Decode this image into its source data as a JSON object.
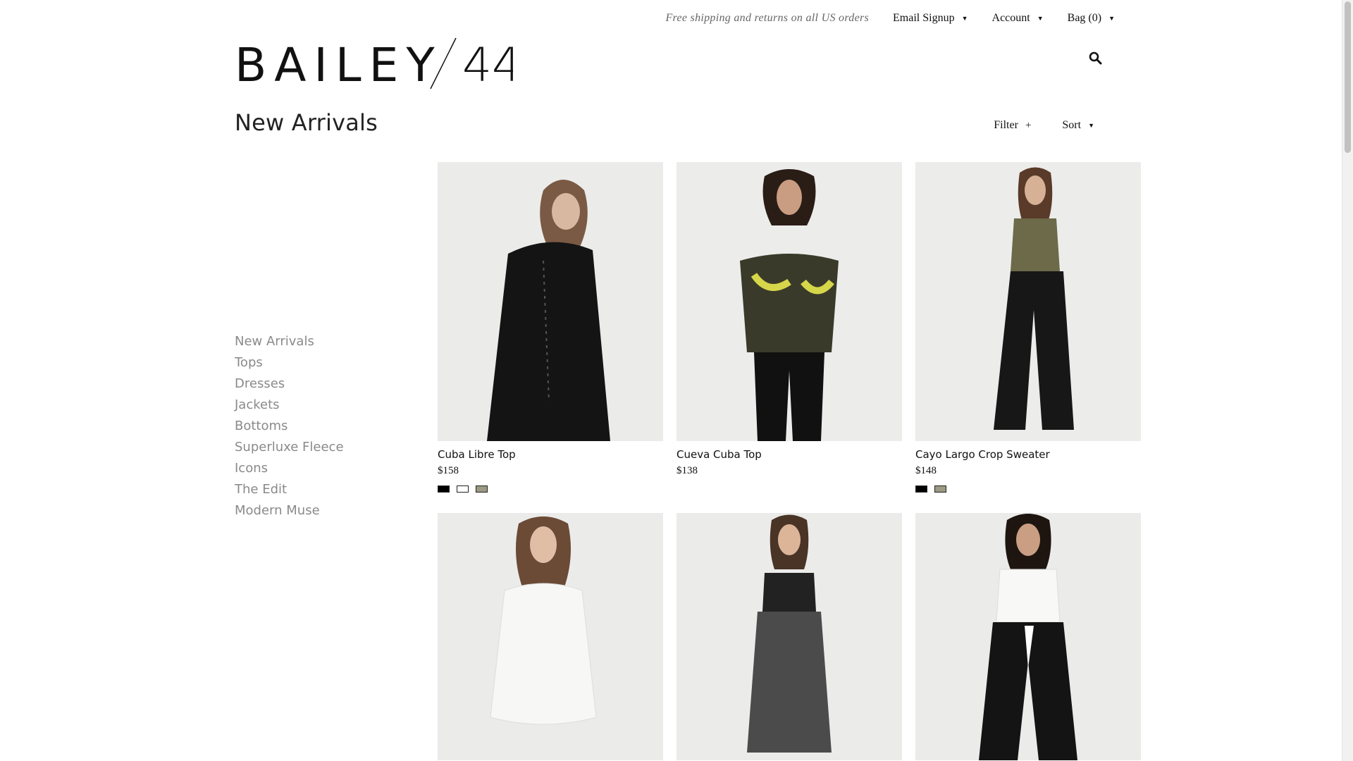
{
  "topbar": {
    "promo": "Free shipping and returns on all US orders",
    "email_signup": "Email Signup",
    "account": "Account",
    "bag": "Bag (0)"
  },
  "logo": {
    "text": "BAILEY",
    "number": "44"
  },
  "icons": {
    "search": "search-icon",
    "caret": "caret-down-icon",
    "plus": "plus-icon"
  },
  "page": {
    "title": "New Arrivals"
  },
  "tools": {
    "filter": "Filter",
    "filter_symbol": "+",
    "sort": "Sort"
  },
  "sidebar": {
    "items": [
      {
        "label": "New Arrivals"
      },
      {
        "label": "Tops"
      },
      {
        "label": "Dresses"
      },
      {
        "label": "Jackets"
      },
      {
        "label": "Bottoms"
      },
      {
        "label": "Superluxe Fleece"
      },
      {
        "label": "Icons"
      },
      {
        "label": "The Edit"
      },
      {
        "label": "Modern Muse"
      }
    ]
  },
  "products": [
    {
      "name": "Cuba Libre Top",
      "price": "$158",
      "swatches": [
        "#000000",
        "#ffffff",
        "#9c9a82"
      ]
    },
    {
      "name": "Cueva Cuba Top",
      "price": "$138",
      "swatches": []
    },
    {
      "name": "Cayo Largo Crop Sweater",
      "price": "$148",
      "swatches": [
        "#000000",
        "#9c9a82"
      ]
    },
    {
      "name": "",
      "price": "",
      "swatches": []
    },
    {
      "name": "",
      "price": "",
      "swatches": []
    },
    {
      "name": "",
      "price": "",
      "swatches": []
    }
  ],
  "colors": {
    "background": "#ffffff",
    "photo_bg": "#e9e9e9",
    "nav_text": "#8a8a8a",
    "text": "#111111"
  }
}
